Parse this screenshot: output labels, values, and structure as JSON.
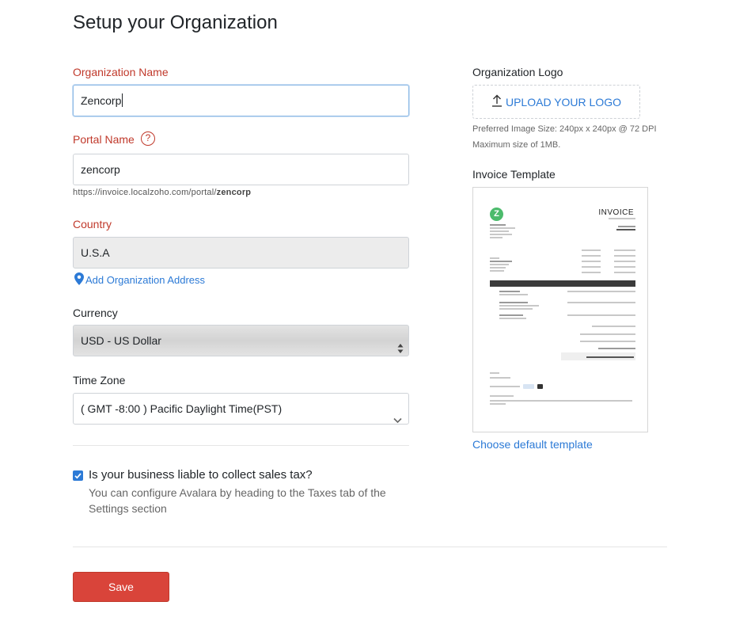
{
  "page": {
    "title": "Setup your Organization"
  },
  "form": {
    "org_name": {
      "label": "Organization Name",
      "value": "Zencorp"
    },
    "portal_name": {
      "label": "Portal Name",
      "help_glyph": "?",
      "value": "zencorp",
      "url_prefix": "https://invoice.localzoho.com/portal/",
      "url_slug": "zencorp"
    },
    "country": {
      "label": "Country",
      "value": "U.S.A",
      "add_address_link": "Add Organization Address"
    },
    "currency": {
      "label": "Currency",
      "value": "USD - US Dollar"
    },
    "timezone": {
      "label": "Time Zone",
      "value": "( GMT -8:00 ) Pacific Daylight Time(PST)"
    },
    "sales_tax": {
      "checked": true,
      "question": "Is your business liable to collect sales tax?",
      "help": "You can configure Avalara by heading to the Taxes tab of the Settings section"
    },
    "save_label": "Save"
  },
  "logo": {
    "label": "Organization Logo",
    "upload_label": "UPLOAD YOUR LOGO",
    "size_hint": "Preferred Image Size: 240px x 240px @ 72 DPI",
    "max_hint": "Maximum size of 1MB."
  },
  "template": {
    "label": "Invoice Template",
    "preview_heading": "INVOICE",
    "preview_logo_letter": "Z",
    "choose_link": "Choose default template"
  },
  "colors": {
    "required_label": "#c0392b",
    "link": "#2c7ad6",
    "save_button": "#d9443a",
    "invoice_logo": "#4cbb6c"
  },
  "icons": [
    "help-icon",
    "map-pin-icon",
    "select-arrows-icon",
    "chevron-down-icon",
    "checkbox-checked-icon",
    "upload-icon"
  ]
}
